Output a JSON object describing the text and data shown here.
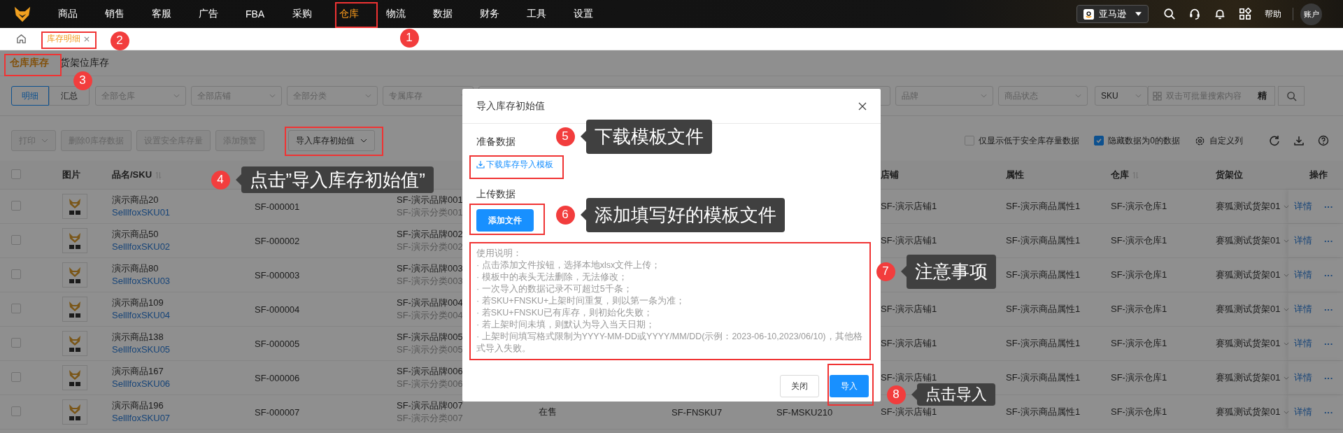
{
  "top_nav": {
    "menu": [
      {
        "label": "商品",
        "selected": false
      },
      {
        "label": "销售",
        "selected": false
      },
      {
        "label": "客服",
        "selected": false
      },
      {
        "label": "广告",
        "selected": false
      },
      {
        "label": "FBA",
        "selected": false
      },
      {
        "label": "采购",
        "selected": false
      },
      {
        "label": "仓库",
        "selected": true
      },
      {
        "label": "物流",
        "selected": false
      },
      {
        "label": "数据",
        "selected": false
      },
      {
        "label": "财务",
        "selected": false
      },
      {
        "label": "工具",
        "selected": false
      },
      {
        "label": "设置",
        "selected": false
      }
    ],
    "marketplace": "亚马逊",
    "help": "帮助",
    "account": "账户"
  },
  "page_tabs": [
    {
      "label": "库存明细",
      "selected": true
    }
  ],
  "sub_tabs": [
    {
      "label": "仓库库存",
      "selected": true
    },
    {
      "label": "货架位库存",
      "selected": false
    }
  ],
  "filters": {
    "view": [
      {
        "label": "明细",
        "selected": true
      },
      {
        "label": "汇总",
        "selected": false
      }
    ],
    "selects_left": [
      {
        "placeholder": "全部仓库"
      },
      {
        "placeholder": "全部店铺"
      },
      {
        "placeholder": "全部分类"
      },
      {
        "placeholder": "专属库存"
      }
    ],
    "selects_right": [
      {
        "placeholder": "品牌"
      },
      {
        "placeholder": "商品状态"
      }
    ],
    "search_field": "SKU",
    "search_placeholder": "双击可批量搜索内容",
    "exact_toggle": "精"
  },
  "toolbar": {
    "buttons": [
      {
        "label": "打印",
        "dropdown": true,
        "disabled": true
      },
      {
        "label": "删除0库存数据",
        "dropdown": false,
        "disabled": true
      },
      {
        "label": "设置安全库存量",
        "dropdown": false,
        "disabled": true
      },
      {
        "label": "添加预警",
        "dropdown": false,
        "disabled": true
      },
      {
        "label": "导入库存初始值",
        "dropdown": true,
        "disabled": false
      }
    ],
    "options": [
      {
        "label": "仅显示低于安全库存量数据",
        "checked": false
      },
      {
        "label": "隐藏数据为0的数据",
        "checked": true
      }
    ],
    "custom_columns": "自定义列"
  },
  "table": {
    "select_all_checked": false,
    "columns": [
      {
        "label": "图片",
        "sortable": false
      },
      {
        "label": "品名/SKU",
        "sortable": true
      },
      {
        "label": "店铺",
        "sortable": false
      },
      {
        "label": "属性",
        "sortable": false
      },
      {
        "label": "仓库",
        "sortable": true
      },
      {
        "label": "货架位",
        "sortable": false
      },
      {
        "label": "操作",
        "sortable": false
      }
    ],
    "rows": [
      {
        "checked": false,
        "name": "演示商品20",
        "sku": "SelllfoxSKU01",
        "code": "SF-000001",
        "brand": "SF-演示品牌001",
        "category": "SF-演示分类001",
        "shop": "SF-演示店铺1",
        "attribute": "SF-演示商品属性1",
        "warehouse": "SF-演示仓库1",
        "shelf": "赛狐测试货架01",
        "detail": "详情",
        "more": "···"
      },
      {
        "checked": false,
        "name": "演示商品50",
        "sku": "SelllfoxSKU02",
        "code": "SF-000002",
        "brand": "SF-演示品牌002",
        "category": "SF-演示分类002",
        "shop": "SF-演示店铺1",
        "attribute": "SF-演示商品属性1",
        "warehouse": "SF-演示仓库1",
        "shelf": "赛狐测试货架01",
        "detail": "详情",
        "more": "···"
      },
      {
        "checked": false,
        "name": "演示商品80",
        "sku": "SelllfoxSKU03",
        "code": "SF-000003",
        "brand": "SF-演示品牌003",
        "category": "SF-演示分类003",
        "attribute": "SF-演示商品属性1",
        "warehouse": "SF-演示仓库1",
        "shelf": "赛狐测试货架01",
        "detail": "详情",
        "more": "···"
      },
      {
        "checked": false,
        "name": "演示商品109",
        "sku": "SelllfoxSKU04",
        "code": "SF-000004",
        "brand": "SF-演示品牌004",
        "category": "SF-演示分类004",
        "shop": "SF-演示店铺1",
        "attribute": "SF-演示商品属性1",
        "warehouse": "SF-演示仓库1",
        "shelf": "赛狐测试货架01",
        "detail": "详情",
        "more": "···"
      },
      {
        "checked": false,
        "name": "演示商品138",
        "sku": "SelllfoxSKU05",
        "code": "SF-000005",
        "brand": "SF-演示品牌005",
        "category": "SF-演示分类005",
        "shop": "SF-演示店铺1",
        "attribute": "SF-演示商品属性1",
        "warehouse": "SF-演示仓库1",
        "shelf": "赛狐测试货架01",
        "detail": "详情",
        "more": "···"
      },
      {
        "checked": false,
        "name": "演示商品167",
        "sku": "SelllfoxSKU06",
        "code": "SF-000006",
        "brand": "SF-演示品牌006",
        "category": "SF-演示分类006",
        "shop": "SF-演示店铺1",
        "attribute": "SF-演示商品属性1",
        "warehouse": "SF-演示仓库1",
        "shelf": "赛狐测试货架01",
        "detail": "详情",
        "more": "···"
      },
      {
        "checked": false,
        "name": "演示商品196",
        "sku": "SelllfoxSKU07",
        "code": "SF-000007",
        "brand": "SF-演示品牌007",
        "category": "SF-演示分类007",
        "status": "在售",
        "fnsku": "SF-FNSKU7",
        "msku": "SF-MSKU210",
        "shop": "SF-演示店铺1",
        "attribute": "SF-演示商品属性1",
        "warehouse": "SF-演示仓库1",
        "shelf": "赛狐测试货架01",
        "detail": "详情",
        "more": "···"
      }
    ]
  },
  "modal": {
    "title": "导入库存初始值",
    "prepare_label": "准备数据",
    "download_link": "下载库存导入模板",
    "upload_label": "上传数据",
    "add_file_button": "添加文件",
    "notes": {
      "title": "使用说明：",
      "items": [
        "· 点击添加文件按钮，选择本地xlsx文件上传；",
        "· 模板中的表头无法删除，无法修改；",
        "· 一次导入的数据记录不可超过5千条；",
        "· 若SKU+FNSKU+上架时间重复，则以第一条为准；",
        "· 若SKU+FNSKU已有库存，则初始化失败；",
        "· 若上架时间未填，则默认为导入当天日期；",
        "· 上架时间填写格式限制为YYYY-MM-DD或YYYY/MM/DD(示例：2023-06-10,2023/06/10)，其他格式导入失败。"
      ]
    },
    "buttons": [
      {
        "label": "关闭",
        "kind": "default"
      },
      {
        "label": "导入",
        "kind": "primary"
      }
    ]
  },
  "annotations": [
    {
      "number": "1",
      "boxed": true
    },
    {
      "number": "2",
      "boxed": true
    },
    {
      "number": "3",
      "boxed": true
    },
    {
      "number": "4",
      "boxed": true,
      "callout": "点击”导入库存初始值”"
    },
    {
      "number": "5",
      "boxed": true,
      "callout": "下载模板文件"
    },
    {
      "number": "6",
      "boxed": true,
      "callout": "添加填写好的模板文件"
    },
    {
      "number": "7",
      "boxed": true,
      "callout": "注意事项"
    },
    {
      "number": "8",
      "boxed": true,
      "callout": "点击导入"
    }
  ]
}
